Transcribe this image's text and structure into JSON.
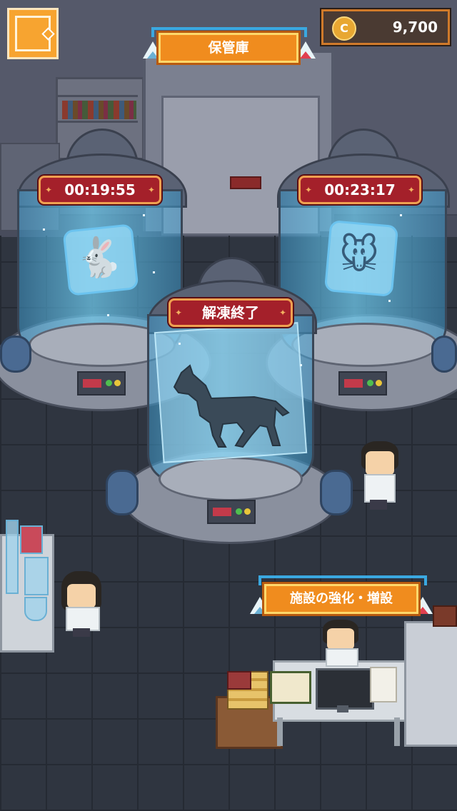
{
  "hud": {
    "menu_button_icon": "menu-square-icon",
    "coin_symbol": "C",
    "coin_count": "9,700"
  },
  "signs": {
    "storage_label": "保管庫",
    "facility_label": "施設の強化・増設"
  },
  "tanks": [
    {
      "status": "00:19:55",
      "animal": "rabbit"
    },
    {
      "status": "00:23:17",
      "animal": "mouse"
    },
    {
      "status": "解凍終了",
      "animal": "horse"
    }
  ],
  "colors": {
    "accent_orange": "#f08c1e",
    "timer_red": "#a4202a",
    "coin_gold": "#e8a732",
    "ice_blue": "#6bc3ef"
  }
}
